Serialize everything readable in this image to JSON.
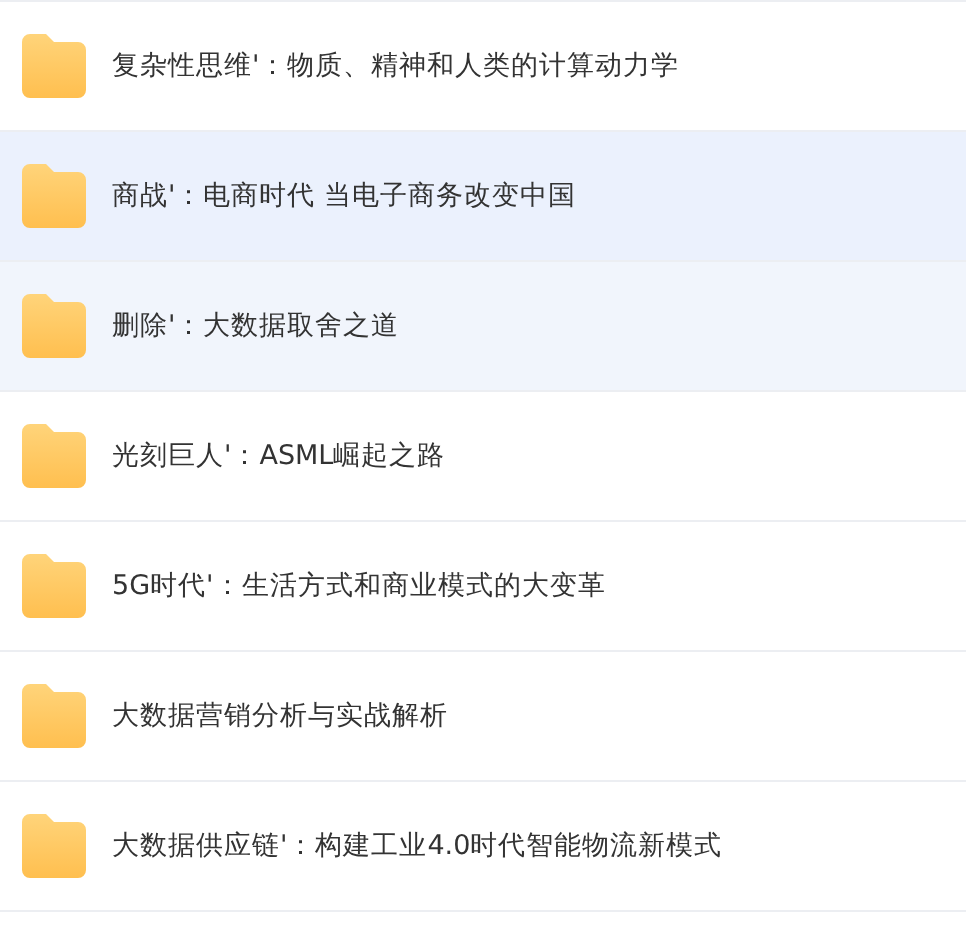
{
  "folders": [
    {
      "name": "复杂性思维'：物质、精神和人类的计算动力学",
      "selected": false,
      "hovered": false
    },
    {
      "name": "商战'：电商时代 当电子商务改变中国",
      "selected": true,
      "hovered": false
    },
    {
      "name": "删除'：大数据取舍之道",
      "selected": false,
      "hovered": true
    },
    {
      "name": "光刻巨人'：ASML崛起之路",
      "selected": false,
      "hovered": false
    },
    {
      "name": "5G时代'：生活方式和商业模式的大变革",
      "selected": false,
      "hovered": false
    },
    {
      "name": "大数据营销分析与实战解析",
      "selected": false,
      "hovered": false
    },
    {
      "name": "大数据供应链'：构建工业4.0时代智能物流新模式",
      "selected": false,
      "hovered": false
    }
  ]
}
